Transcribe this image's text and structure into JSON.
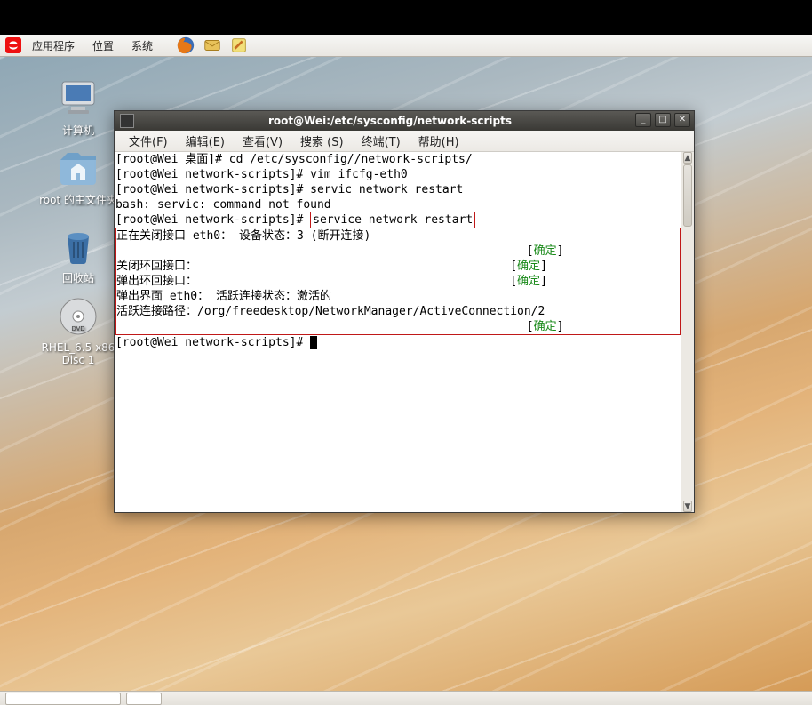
{
  "menubar": {
    "apps": "应用程序",
    "places": "位置",
    "system": "系统"
  },
  "desktop": {
    "computer": "计算机",
    "home": "root 的主文件夹",
    "trash": "回收站",
    "dvd_l1": "RHEL_6.5 x86",
    "dvd_l2": "Disc 1"
  },
  "term": {
    "title": "root@Wei:/etc/sysconfig/network-scripts",
    "menu": {
      "file": "文件(F)",
      "edit": "编辑(E)",
      "view": "查看(V)",
      "search": "搜索 (S)",
      "terminal": "终端(T)",
      "help": "帮助(H)"
    },
    "lines": {
      "l1": "[root@Wei 桌面]# cd /etc/sysconfig//network-scripts/",
      "l2": "[root@Wei network-scripts]# vim ifcfg-eth0",
      "l3": "[root@Wei network-scripts]# servic network restart",
      "l4": "bash: servic: command not found",
      "l5p": "[root@Wei network-scripts]# ",
      "l5c": "service network restart",
      "b1": "正在关闭接口 eth0： 设备状态：3 (断开连接)",
      "b2": "关闭环回接口：",
      "b3": "弹出环回接口：",
      "b4": "弹出界面 eth0： 活跃连接状态：激活的",
      "b5": "活跃连接路径：/org/freedesktop/NetworkManager/ActiveConnection/2",
      "ok": "确定",
      "last": "[root@Wei network-scripts]# "
    },
    "wbtn": {
      "min": "_",
      "max": "□",
      "close": "✕"
    }
  }
}
